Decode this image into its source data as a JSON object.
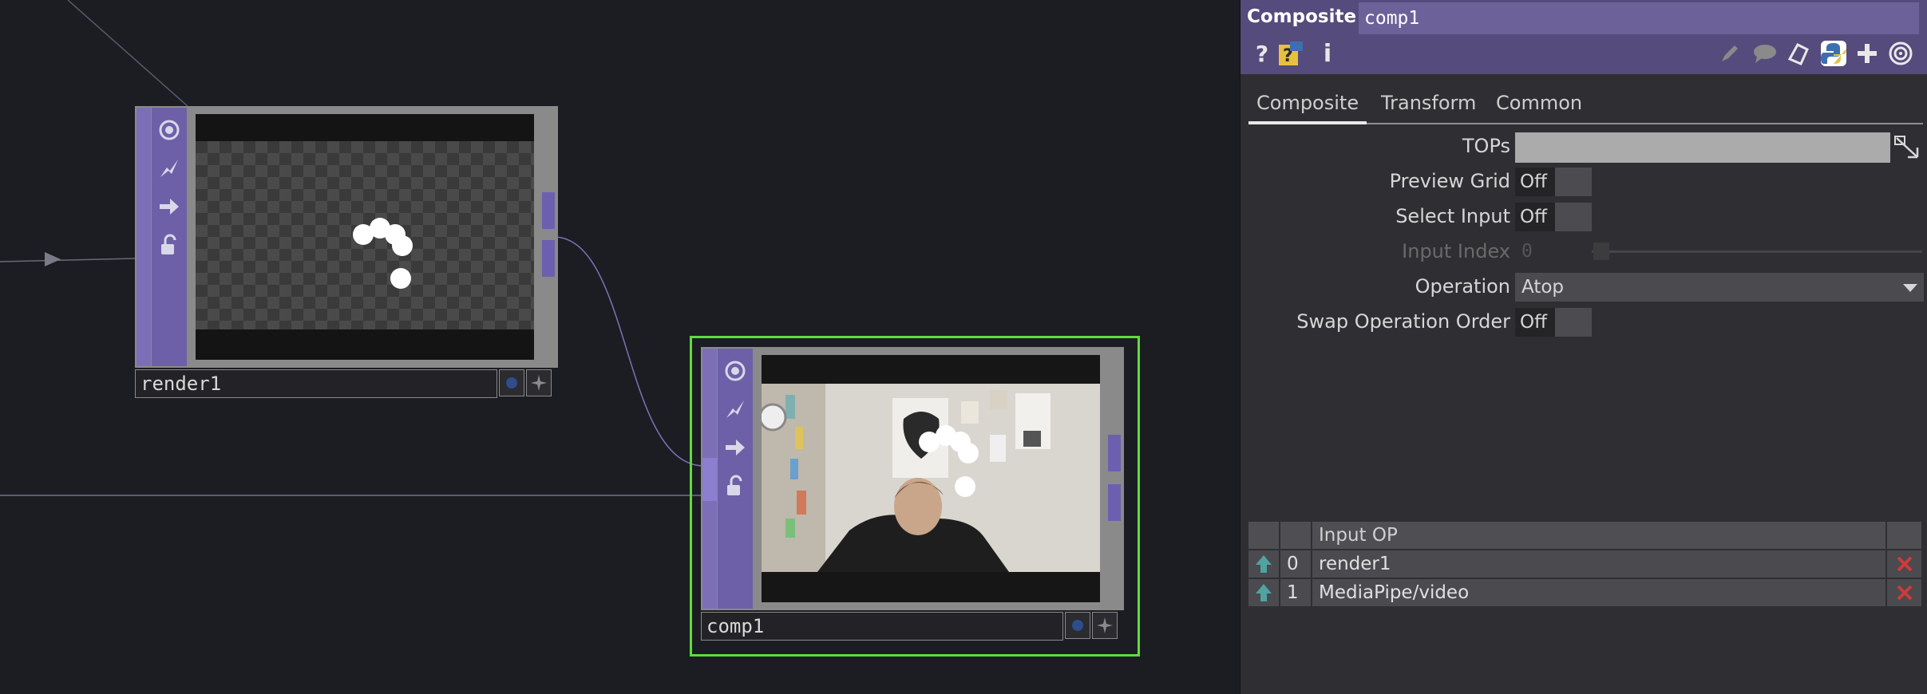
{
  "network": {
    "nodes": [
      {
        "name": "render1"
      },
      {
        "name": "comp1"
      }
    ]
  },
  "params": {
    "op_type": "Composite",
    "op_name": "comp1",
    "tabs": [
      {
        "label": "Composite"
      },
      {
        "label": "Transform"
      },
      {
        "label": "Common"
      }
    ],
    "fields": {
      "tops_label": "TOPs",
      "preview_grid_label": "Preview Grid",
      "preview_grid_value": "Off",
      "select_input_label": "Select Input",
      "select_input_value": "Off",
      "input_index_label": "Input Index",
      "input_index_value": "0",
      "operation_label": "Operation",
      "operation_value": "Atop",
      "swap_order_label": "Swap Operation Order",
      "swap_order_value": "Off"
    },
    "table": {
      "header": "Input OP",
      "rows": [
        {
          "index": "0",
          "op": "render1"
        },
        {
          "index": "1",
          "op": "MediaPipe/video"
        }
      ]
    }
  },
  "colors": {
    "selected_node_border": "#5fdc3c",
    "node_sidebar": "#7c6fb8",
    "header": "#554b7c",
    "delete_x": "#d03a3a",
    "up_arrow": "#4fa3a0"
  }
}
